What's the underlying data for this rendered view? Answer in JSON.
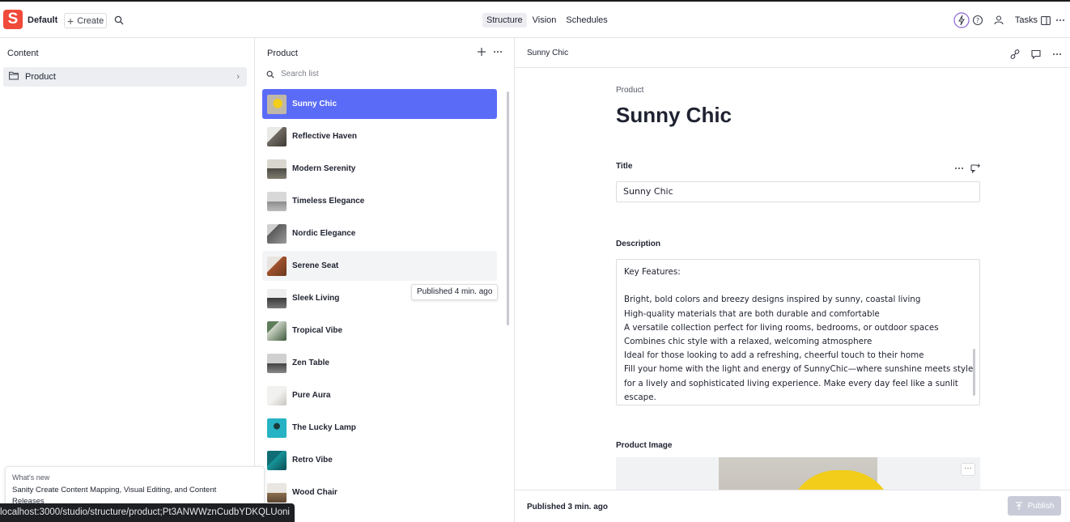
{
  "topbar": {
    "logo_letter": "S",
    "workspace": "Default",
    "create_label": "Create",
    "nav": [
      {
        "label": "Structure",
        "active": true
      },
      {
        "label": "Vision",
        "active": false
      },
      {
        "label": "Schedules",
        "active": false
      }
    ],
    "tasks_label": "Tasks"
  },
  "content_pane": {
    "title": "Content",
    "items": [
      {
        "label": "Product"
      }
    ]
  },
  "product_pane": {
    "title": "Product",
    "search_placeholder": "Search list",
    "items": [
      {
        "label": "Sunny Chic",
        "selected": true
      },
      {
        "label": "Reflective Haven"
      },
      {
        "label": "Modern Serenity"
      },
      {
        "label": "Timeless Elegance"
      },
      {
        "label": "Nordic Elegance"
      },
      {
        "label": "Serene Seat",
        "hovered": true
      },
      {
        "label": "Sleek Living"
      },
      {
        "label": "Tropical Vibe"
      },
      {
        "label": "Zen Table"
      },
      {
        "label": "Pure Aura"
      },
      {
        "label": "The Lucky Lamp"
      },
      {
        "label": "Retro Vibe"
      },
      {
        "label": "Wood Chair"
      }
    ],
    "tooltip": "Published 4 min. ago"
  },
  "document": {
    "header": "Sunny Chic",
    "type_label": "Product",
    "title": "Sunny Chic",
    "fields": {
      "title_label": "Title",
      "title_value": "Sunny Chic",
      "description_label": "Description",
      "description_lines": [
        "Key Features:",
        "",
        "Bright, bold colors and breezy designs inspired by sunny, coastal living",
        "High-quality materials that are both durable and comfortable",
        "A versatile collection perfect for living rooms, bedrooms, or outdoor spaces",
        "Combines chic style with a relaxed, welcoming atmosphere",
        "Ideal for those looking to add a refreshing, cheerful touch to their home",
        "Fill your home with the light and energy of SunnyChic—where sunshine meets style",
        "for a lively and sophisticated living experience. Make every day feel like a sunlit",
        "escape."
      ],
      "image_label": "Product Image"
    },
    "footer_status": "Published 3 min. ago",
    "publish_label": "Publish"
  },
  "whats_new": {
    "label": "What's new",
    "text": "Sanity Create Content Mapping, Visual Editing, and Content Releases"
  },
  "status_url": "localhost:3000/studio/structure/product;Pt3ANWWznCudbYDKQLUoni",
  "colors": {
    "accent": "#5a6cf7",
    "brand": "#f04a3a",
    "product_yellow": "#f2cd19"
  }
}
